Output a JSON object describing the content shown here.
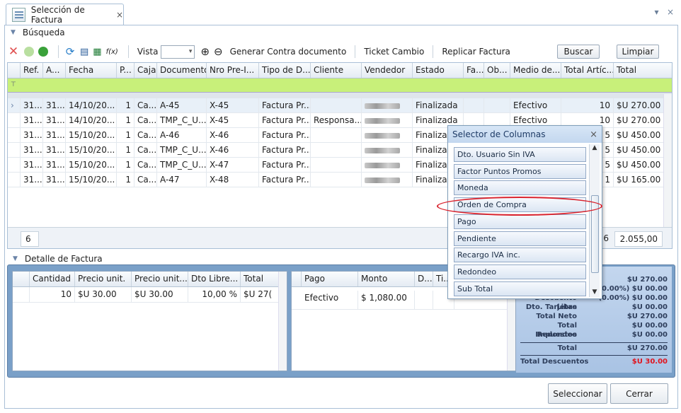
{
  "tab": {
    "title": "Selección de Factura",
    "close": "×"
  },
  "window": {
    "dropdown": "▾",
    "close": "×"
  },
  "search_section": {
    "label": "Búsqueda"
  },
  "toolbar": {
    "vista_label": "Vista",
    "vista_value": "",
    "btn_generar": "Generar Contra documento",
    "btn_ticket": "Ticket Cambio",
    "btn_replicar": "Replicar Factura",
    "btn_buscar": "Buscar",
    "btn_limpiar": "Limpiar",
    "fx": "f(x)"
  },
  "grid": {
    "columns": [
      "Ref.",
      "A...",
      "Fecha",
      "P...",
      "Caja",
      "Documento",
      "Nro Pre-I...",
      "Tipo de D...",
      "Cliente",
      "Vendedor",
      "Estado",
      "Fa...",
      "Ob...",
      "Medio de...",
      "Total Artíc...",
      "Total"
    ],
    "rows": [
      [
        "31...",
        "31...",
        "14/10/20...",
        "1",
        "Ca...",
        "A-45",
        "X-45",
        "Factura Pr...",
        "",
        "",
        "Finalizada",
        "",
        "",
        "Efectivo",
        "10",
        "$U  270.00"
      ],
      [
        "31...",
        "31...",
        "14/10/20...",
        "1",
        "Ca...",
        "TMP_C_U...",
        "X-45",
        "Factura Pr...",
        "Responsa...",
        "",
        "Finalizada",
        "",
        "",
        "Efectivo",
        "10",
        "$U  270.00"
      ],
      [
        "31...",
        "31...",
        "15/10/20...",
        "1",
        "Ca...",
        "A-46",
        "X-46",
        "Factura Pr...",
        "",
        "",
        "Finalizada",
        "",
        "",
        "",
        "5",
        "$U  450.00"
      ],
      [
        "31...",
        "31...",
        "15/10/20...",
        "1",
        "Ca...",
        "TMP_C_U...",
        "X-46",
        "Factura Pr...",
        "",
        "",
        "Finalizada",
        "",
        "",
        "",
        "5",
        "$U  450.00"
      ],
      [
        "31...",
        "31...",
        "15/10/20...",
        "1",
        "Ca...",
        "TMP_C_U...",
        "X-47",
        "Factura Pr...",
        "",
        "",
        "Finalizada",
        "",
        "",
        "",
        "5",
        "$U  450.00"
      ],
      [
        "31...",
        "31...",
        "15/10/20...",
        "1",
        "Ca...",
        "A-47",
        "X-48",
        "Factura Pr...",
        "",
        "",
        "Finalizada",
        "",
        "",
        "",
        "1",
        "$U  165.00"
      ]
    ],
    "footer_count": "6",
    "footer_articles": "6",
    "footer_total": "2.055,00"
  },
  "detail": {
    "label": "Detalle de Factura",
    "items_columns": [
      "Cantidad",
      "Precio unit.",
      "Precio unit....",
      "Dto Libre...",
      "Total"
    ],
    "items_row": [
      "10",
      "$U      30.00",
      "$U      30.00",
      "10,00 %",
      "$U    27("
    ],
    "pay_columns": [
      "Pago",
      "Monto",
      "D...",
      "Ti..."
    ],
    "pay_row": [
      "Efectivo",
      "$    1,080.00",
      "",
      ""
    ],
    "totals": [
      {
        "label": "",
        "value": "$U 270.00"
      },
      {
        "label": "",
        "value": "(0.00%) $U 00.00"
      },
      {
        "label": "Descuento Libre",
        "value": "(0.00%) $U 00.00"
      },
      {
        "label": "Dto. Tarjetas",
        "value": "$U 00.00"
      },
      {
        "label": "Total Neto",
        "value": "$U 270.00"
      },
      {
        "label": "Total Impuestos",
        "value": "$U 00.00"
      },
      {
        "label": "Redondeo",
        "value": "$U 00.00"
      },
      {
        "label": "Total",
        "value": "$U 270.00"
      },
      {
        "label": "Total Descuentos",
        "value": "$U 30.00"
      }
    ]
  },
  "column_selector": {
    "title": "Selector de Columnas",
    "close": "×",
    "items": [
      "Dto. Usuario Sin IVA",
      "Factor Puntos Promos",
      "Moneda",
      "Orden de Compra",
      "Pago",
      "Pendiente",
      "Recargo IVA inc.",
      "Redondeo",
      "Sub Total"
    ]
  },
  "actions": {
    "select": "Seleccionar",
    "close": "Cerrar"
  },
  "colors": {
    "accent": "#c8f07a",
    "highlight": "#d9232e",
    "panel": "#7aa0c8",
    "discount": "#e0141e"
  }
}
